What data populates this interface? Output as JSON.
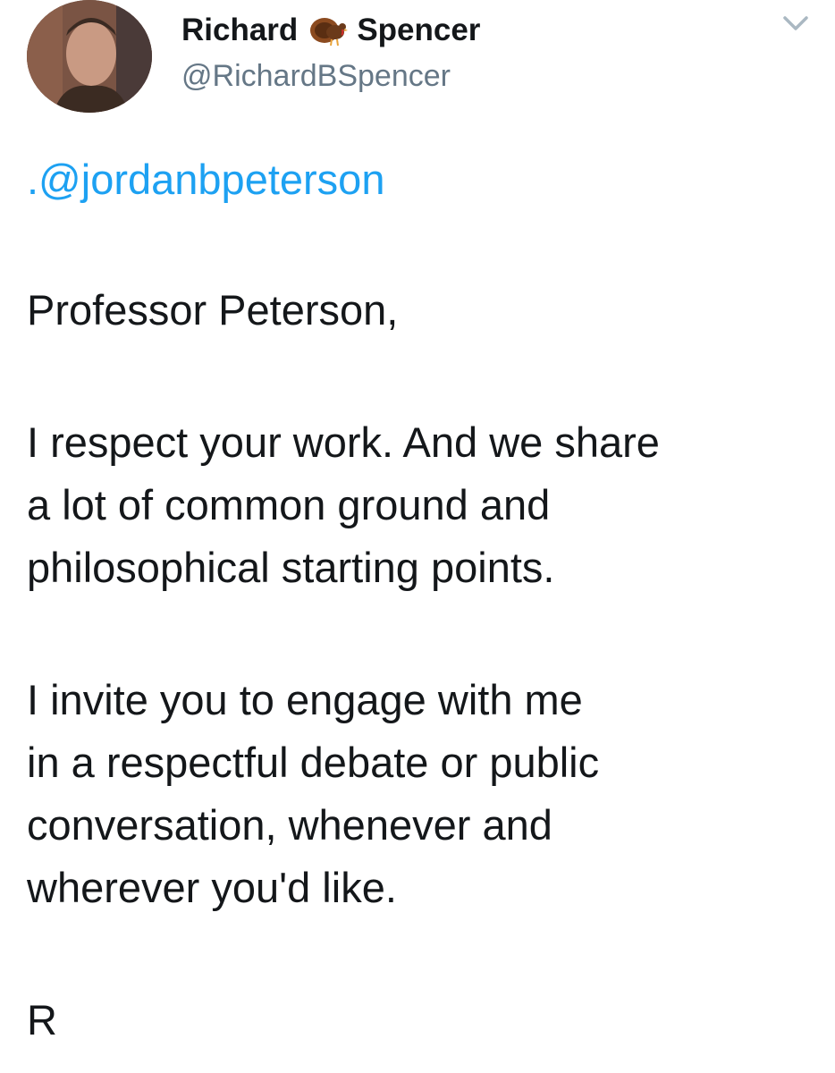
{
  "author": {
    "first_name": "Richard",
    "last_name": "Spencer",
    "emoji_icon": "turkey-icon",
    "handle": "@RichardBSpencer"
  },
  "tweet": {
    "mention": ".@jordanbpeterson",
    "salutation": "Professor Peterson,",
    "paragraph1": [
      "I respect your work. And we share",
      "a lot of common ground and",
      "philosophical starting points."
    ],
    "paragraph2": [
      "I invite you to engage with me",
      "in a respectful debate or public",
      "conversation, whenever and",
      "wherever you'd like."
    ],
    "signoff": "R"
  },
  "colors": {
    "link": "#1da1f2",
    "secondary_text": "#657786",
    "primary_text": "#14171a"
  }
}
